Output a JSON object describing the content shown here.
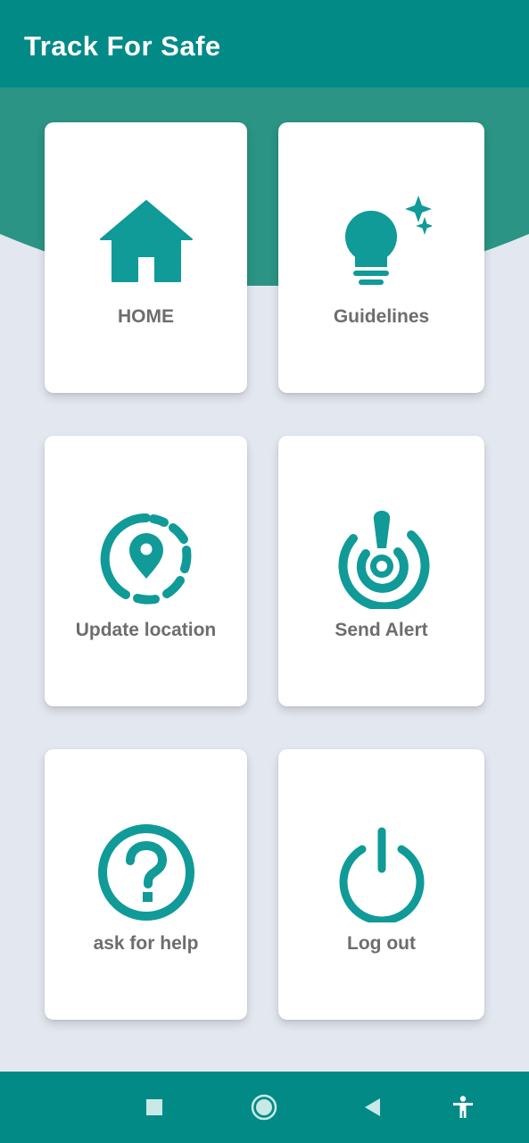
{
  "app_bar": {
    "title": "Track For Safe"
  },
  "colors": {
    "primary": "#028a87",
    "header_curve": "#2b9484",
    "icon": "#109a98",
    "background": "#e3e7ef",
    "card": "#ffffff",
    "label": "#6d6d6d"
  },
  "menu": {
    "home": {
      "label": "HOME",
      "icon": "home-icon"
    },
    "guidelines": {
      "label": "Guidelines",
      "icon": "lightbulb-sparkle-icon"
    },
    "update_location": {
      "label": "Update location",
      "icon": "location-pin-icon"
    },
    "send_alert": {
      "label": "Send Alert",
      "icon": "alert-signal-icon"
    },
    "ask_for_help": {
      "label": "ask for help",
      "icon": "help-circle-icon"
    },
    "log_out": {
      "label": "Log out",
      "icon": "power-icon"
    }
  },
  "nav_bar": {
    "items": [
      "recents-square-icon",
      "home-circle-icon",
      "back-triangle-icon",
      "accessibility-icon"
    ]
  }
}
